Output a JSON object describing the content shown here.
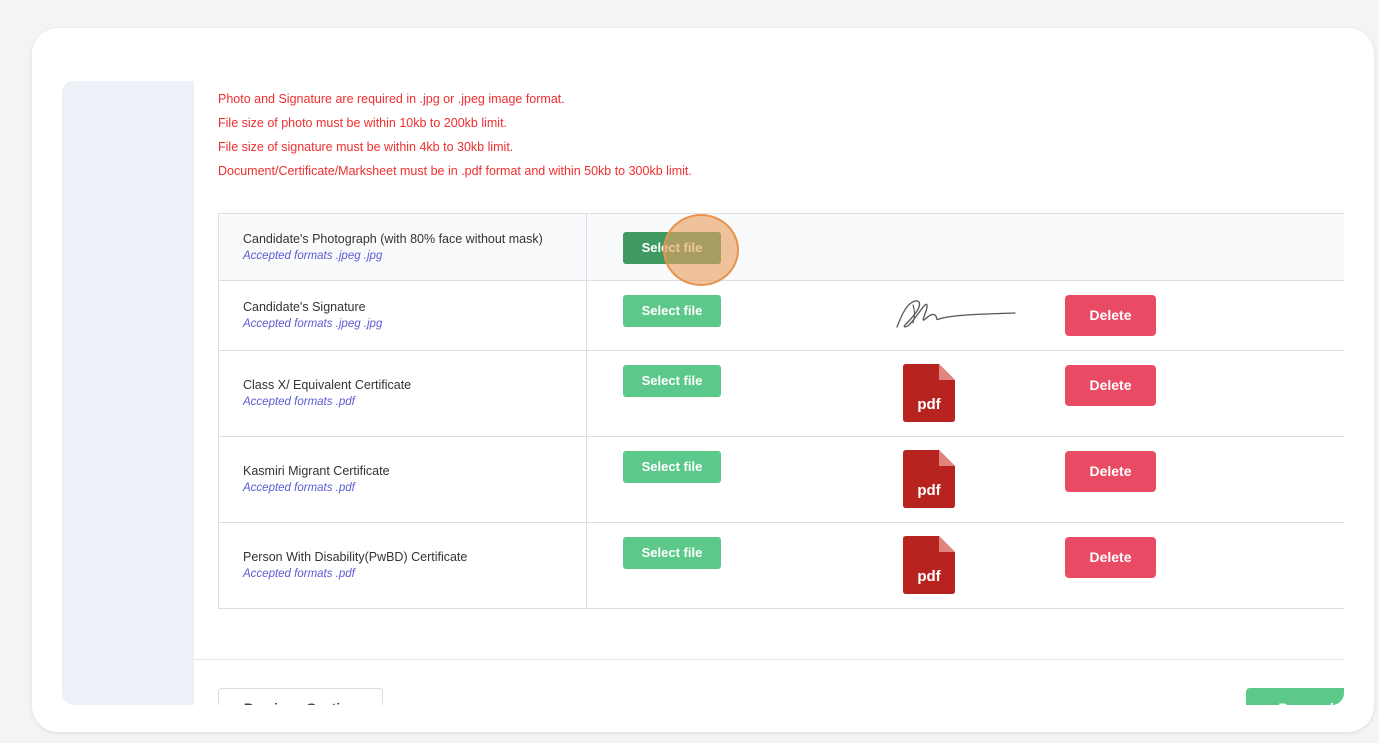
{
  "notes": [
    "Photo and Signature are required in .jpg or .jpeg image format.",
    "File size of photo must be within 10kb to 200kb limit.",
    "File size of signature must be within 4kb to 30kb limit.",
    "Document/Certificate/Marksheet must be in .pdf format and within 50kb to 300kb limit."
  ],
  "documents": [
    {
      "title": "Candidate's Photograph (with 80% face without mask)",
      "formats": "Accepted formats .jpeg .jpg",
      "select_label": "Select file"
    },
    {
      "title": "Candidate's Signature",
      "formats": "Accepted formats .jpeg .jpg",
      "select_label": "Select file",
      "delete_label": "Delete",
      "preview": "signature"
    },
    {
      "title": "Class X/ Equivalent Certificate",
      "formats": "Accepted formats .pdf",
      "select_label": "Select file",
      "delete_label": "Delete",
      "preview": "pdf",
      "preview_label": "pdf"
    },
    {
      "title": "Kasmiri Migrant Certificate",
      "formats": "Accepted formats .pdf",
      "select_label": "Select file",
      "delete_label": "Delete",
      "preview": "pdf",
      "preview_label": "pdf"
    },
    {
      "title": "Person With Disability(PwBD) Certificate",
      "formats": "Accepted formats .pdf",
      "select_label": "Select file",
      "delete_label": "Delete",
      "preview": "pdf",
      "preview_label": "pdf"
    }
  ],
  "footer": {
    "previous_label": "Previous Section",
    "proceed_label": "Proceed"
  },
  "colors": {
    "note_red": "#ef2f2f",
    "select_green": "#5cc98b",
    "delete_red": "#e94a64",
    "format_blue": "#5b5bd6",
    "pdf_red": "#b7231f"
  },
  "icons": [
    "pdf-icon",
    "signature-image"
  ]
}
